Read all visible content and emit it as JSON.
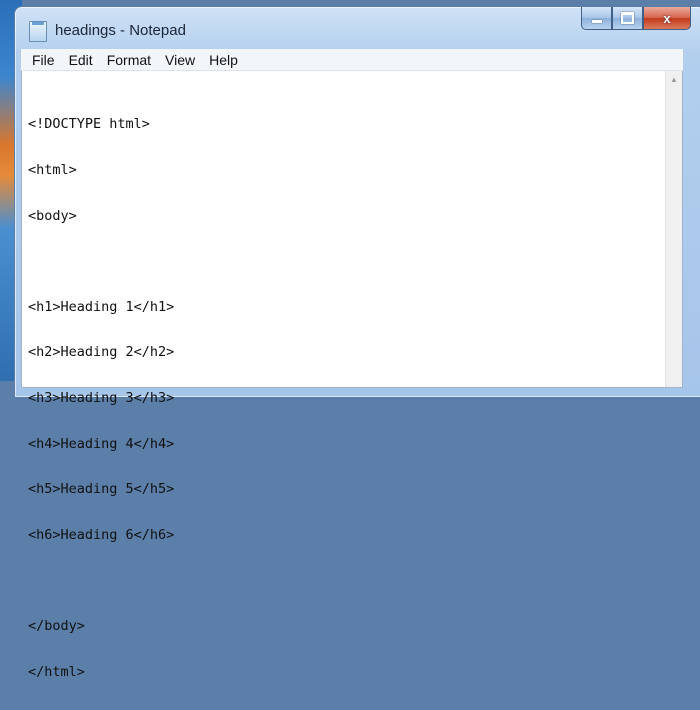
{
  "window": {
    "title": "headings - Notepad",
    "controls": {
      "minimize_icon": "minimize-icon",
      "maximize_icon": "maximize-icon",
      "close_glyph": "x"
    }
  },
  "menu": [
    "File",
    "Edit",
    "Format",
    "View",
    "Help"
  ],
  "editor": {
    "lines": [
      "<!DOCTYPE html>",
      "<html>",
      "<body>",
      "",
      "<h1>Heading 1</h1>",
      "<h2>Heading 2</h2>",
      "<h3>Heading 3</h3>",
      "<h4>Heading 4</h4>",
      "<h5>Heading 5</h5>",
      "<h6>Heading 6</h6>",
      "",
      "</body>",
      "</html>"
    ]
  },
  "scrollbar": {
    "up_arrow": "▲"
  },
  "colors": {
    "close_red": "#c23b1e",
    "frame_blue": "#a6c5ea",
    "menu_bg": "#f2f5fa"
  }
}
